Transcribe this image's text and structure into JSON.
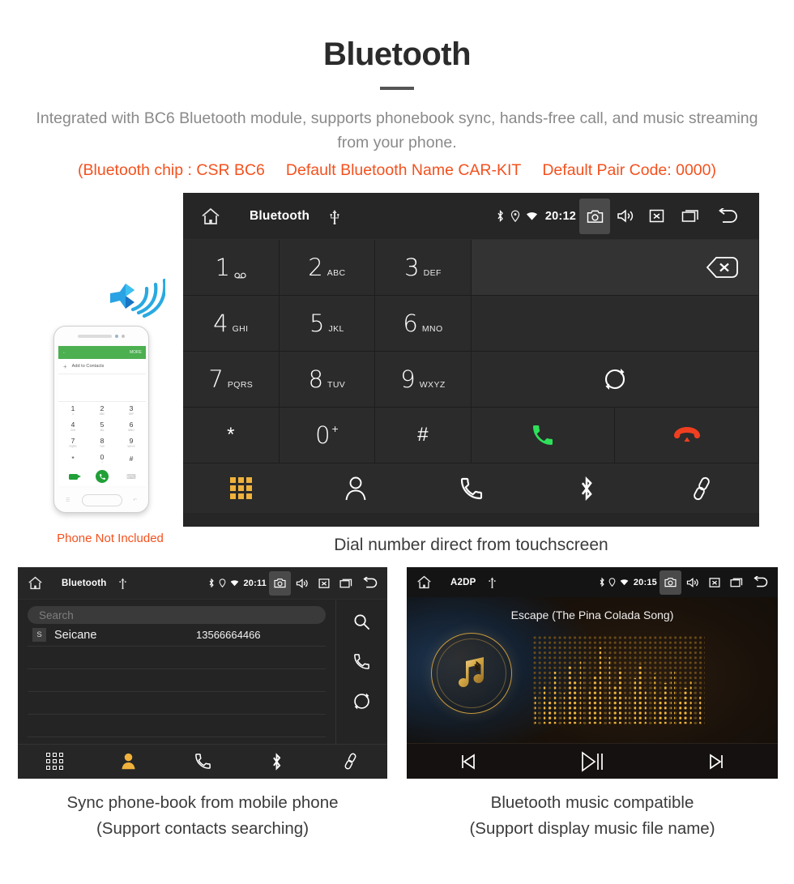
{
  "header": {
    "title": "Bluetooth",
    "subtitle": "Integrated with BC6 Bluetooth module, supports phonebook sync, hands-free call, and music streaming from your phone.",
    "specs": [
      "(Bluetooth chip : CSR BC6",
      "Default Bluetooth Name CAR-KIT",
      "Default Pair Code: 0000)"
    ],
    "accent_color": "#f4511e"
  },
  "dialer": {
    "statusbar": {
      "title": "Bluetooth",
      "time": "20:12",
      "icons": [
        "home-icon",
        "usb-icon",
        "bluetooth-icon",
        "location-icon",
        "wifi-icon",
        "camera-icon",
        "volume-icon",
        "close-box-icon",
        "recents-icon",
        "back-icon"
      ]
    },
    "keys": [
      {
        "num": "1",
        "sub": "∞"
      },
      {
        "num": "2",
        "sub": "ABC"
      },
      {
        "num": "3",
        "sub": "DEF"
      },
      {
        "num": "4",
        "sub": "GHI"
      },
      {
        "num": "5",
        "sub": "JKL"
      },
      {
        "num": "6",
        "sub": "MNO"
      },
      {
        "num": "7",
        "sub": "PQRS"
      },
      {
        "num": "8",
        "sub": "TUV"
      },
      {
        "num": "9",
        "sub": "WXYZ"
      },
      {
        "num": "*",
        "sub": ""
      },
      {
        "num": "0",
        "sub": "+"
      },
      {
        "num": "#",
        "sub": ""
      }
    ],
    "display_value": "",
    "actions": {
      "backspace": "backspace-icon",
      "sync": "sync-icon",
      "call": "call-icon",
      "hangup": "hangup-icon"
    },
    "dock": [
      {
        "name": "dialpad",
        "icon": "dialpad-icon",
        "active": true
      },
      {
        "name": "contacts",
        "icon": "person-icon",
        "active": false
      },
      {
        "name": "call-log",
        "icon": "handset-icon",
        "active": false
      },
      {
        "name": "bluetooth",
        "icon": "bluetooth-icon",
        "active": false
      },
      {
        "name": "link",
        "icon": "link-icon",
        "active": false
      }
    ],
    "active_color": "#f0b23c"
  },
  "phone_illustration": {
    "appbar_label": "MORE",
    "add_contacts": "Add to Contacts",
    "add_plus": "+",
    "keys": [
      {
        "n": "1",
        "s": "∞"
      },
      {
        "n": "2",
        "s": "ABC"
      },
      {
        "n": "3",
        "s": "DEF"
      },
      {
        "n": "4",
        "s": "GHI"
      },
      {
        "n": "5",
        "s": "JKL"
      },
      {
        "n": "6",
        "s": "MNO"
      },
      {
        "n": "7",
        "s": "PQRS"
      },
      {
        "n": "8",
        "s": "TUV"
      },
      {
        "n": "9",
        "s": "WXYZ"
      },
      {
        "n": "*",
        "s": ""
      },
      {
        "n": "0",
        "s": "+"
      },
      {
        "n": "#",
        "s": ""
      }
    ],
    "note": "Phone Not Included",
    "note_color": "#f4511e"
  },
  "captions": {
    "main": "Dial number direct from touchscreen",
    "bottom_left_line1": "Sync phone-book from mobile phone",
    "bottom_left_line2": "(Support contacts searching)",
    "bottom_right_line1": "Bluetooth music compatible",
    "bottom_right_line2": "(Support display music file name)"
  },
  "phonebook": {
    "statusbar": {
      "title": "Bluetooth",
      "time": "20:11"
    },
    "search_placeholder": "Search",
    "contacts": [
      {
        "badge": "S",
        "name": "Seicane",
        "number": "13566664466"
      }
    ],
    "empty_rows": 4,
    "rail": [
      "search-icon",
      "handset-icon",
      "sync-icon"
    ],
    "dock": [
      {
        "name": "dialpad",
        "icon": "dialpad-icon",
        "active": false
      },
      {
        "name": "contacts",
        "icon": "person-icon",
        "active": true
      },
      {
        "name": "call-log",
        "icon": "handset-icon",
        "active": false
      },
      {
        "name": "bluetooth",
        "icon": "bluetooth-icon",
        "active": false
      },
      {
        "name": "link",
        "icon": "link-icon",
        "active": false
      }
    ]
  },
  "music": {
    "statusbar": {
      "title": "A2DP",
      "time": "20:15"
    },
    "song_title": "Escape (The Pina Colada Song)",
    "album_art": "music-note-bluetooth-icon",
    "visualizer": "dot-matrix-equalizer",
    "controls": [
      {
        "name": "previous",
        "icon": "skip-previous-icon"
      },
      {
        "name": "play-pause",
        "icon": "play-pause-icon"
      },
      {
        "name": "next",
        "icon": "skip-next-icon"
      }
    ],
    "accent_color": "#d9a441"
  }
}
